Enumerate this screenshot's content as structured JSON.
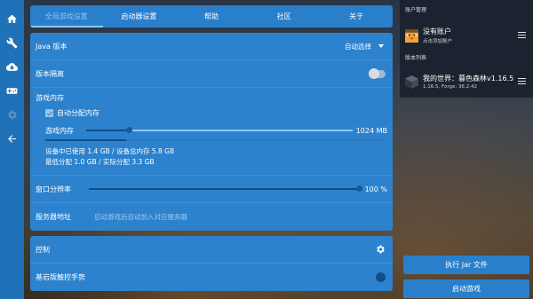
{
  "nav": {
    "items": [
      {
        "name": "home-icon",
        "active": true
      },
      {
        "name": "wrench-icon",
        "active": true
      },
      {
        "name": "cloud-download-icon",
        "active": true
      },
      {
        "name": "gamepad-icon",
        "active": true
      },
      {
        "name": "gear-icon",
        "active": false
      },
      {
        "name": "back-arrow-icon",
        "active": true
      }
    ]
  },
  "tabs": [
    {
      "label": "全局游戏设置",
      "active": true
    },
    {
      "label": "启动器设置",
      "active": false
    },
    {
      "label": "帮助",
      "active": false
    },
    {
      "label": "社区",
      "active": false
    },
    {
      "label": "关于",
      "active": false
    }
  ],
  "settings": {
    "java": {
      "label": "Java 版本",
      "value": "自动选择"
    },
    "isolation": {
      "label": "版本隔离",
      "enabled": false
    },
    "memory": {
      "title": "游戏内存",
      "auto_label": "自动分配内存",
      "auto_checked": true,
      "slider_label": "游戏内存",
      "slider_value": "1024 MB",
      "slider_fraction": 0.16,
      "usage_fraction": 0.24,
      "usage_text": "设备中已使用 1.4 GB / 设备总内存 5.8 GB",
      "alloc_text": "最低分配 1.0 GB / 实际分配 3.3 GB"
    },
    "resolution": {
      "label": "窗口分辨率",
      "value": "100 %",
      "fraction": 1.0
    },
    "server": {
      "label": "服务器地址",
      "placeholder": "启动游戏后自动加入对应服务器"
    }
  },
  "controls": {
    "title": "控制",
    "bedrock_touch": {
      "label": "基岩版触控手势",
      "enabled": false
    }
  },
  "panel": {
    "account_section": "账户管理",
    "account_name": "没有账户",
    "account_hint": "点击添加账户",
    "version_section": "版本列表",
    "version_name": "我的世界：暮色森林v1.16.5",
    "version_sub": "1.16.5, Forge: 36.2.42",
    "run_jar": "执行 Jar 文件",
    "launch": "启动游戏"
  },
  "colors": {
    "accent": "#2a7fcb",
    "rail": "#1f72b8",
    "active_tab": "#8ec7f3"
  }
}
